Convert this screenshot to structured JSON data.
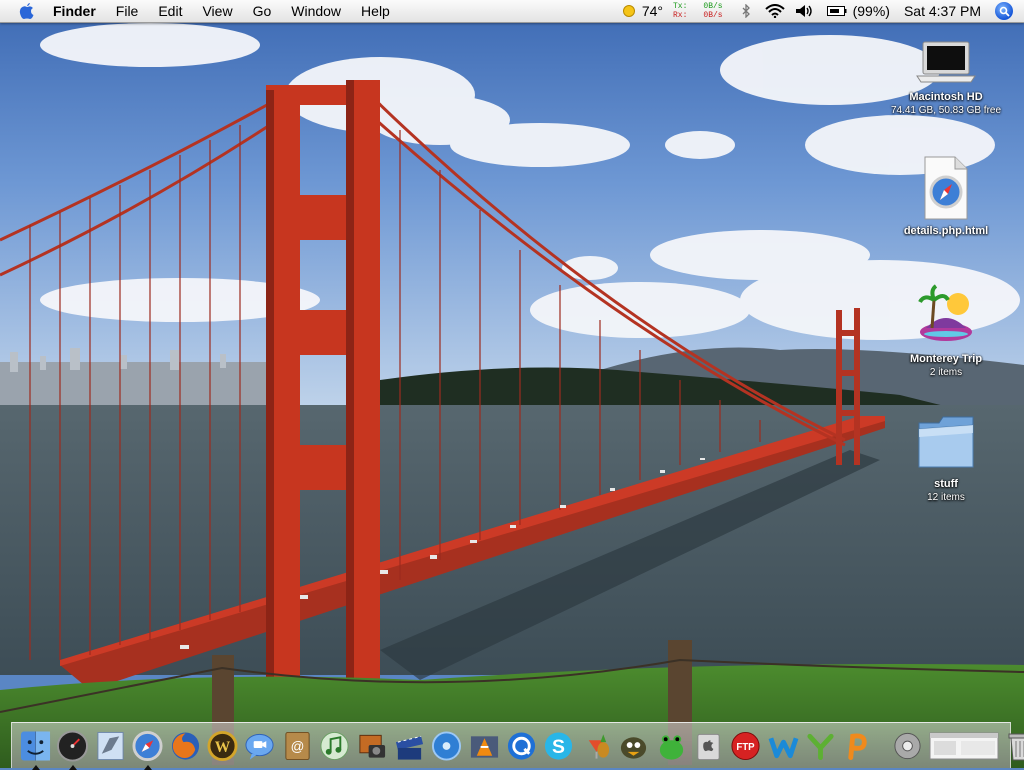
{
  "menubar": {
    "app_name": "Finder",
    "menus": [
      "File",
      "Edit",
      "View",
      "Go",
      "Window",
      "Help"
    ],
    "status": {
      "weather_temp": "74°",
      "net_tx_label": "Tx:",
      "net_tx_value": "0B/s",
      "net_rx_label": "Rx:",
      "net_rx_value": "0B/s",
      "battery": "(99%)",
      "clock": "Sat 4:37 PM"
    }
  },
  "desktop": {
    "icons": [
      {
        "name": "Macintosh HD",
        "detail": "74.41 GB, 50.83 GB free",
        "icon": "hard-drive-icon"
      },
      {
        "name": "details.php.html",
        "detail": "",
        "icon": "safari-document-icon"
      },
      {
        "name": "Monterey Trip",
        "detail": "2 items",
        "icon": "island-folder-icon"
      },
      {
        "name": "stuff",
        "detail": "12 items",
        "icon": "folder-icon"
      }
    ]
  },
  "dock": {
    "apps": [
      {
        "name": "Finder",
        "icon": "finder-icon",
        "running": true
      },
      {
        "name": "Dashboard",
        "icon": "dashboard-icon",
        "running": true
      },
      {
        "name": "Mail",
        "icon": "mail-icon",
        "running": false
      },
      {
        "name": "Safari",
        "icon": "safari-icon",
        "running": true
      },
      {
        "name": "Firefox",
        "icon": "firefox-icon",
        "running": false
      },
      {
        "name": "World of Warcraft",
        "icon": "warcraft-icon",
        "running": false
      },
      {
        "name": "iChat",
        "icon": "ichat-icon",
        "running": false
      },
      {
        "name": "Address Book",
        "icon": "address-book-icon",
        "running": false
      },
      {
        "name": "iTunes",
        "icon": "itunes-icon",
        "running": false
      },
      {
        "name": "iPhoto",
        "icon": "iphoto-icon",
        "running": false
      },
      {
        "name": "iMovie",
        "icon": "imovie-icon",
        "running": false
      },
      {
        "name": "iDVD",
        "icon": "idvd-icon",
        "running": false
      },
      {
        "name": "VLC",
        "icon": "vlc-icon",
        "running": false
      },
      {
        "name": "QuickTime",
        "icon": "quicktime-icon",
        "running": false
      },
      {
        "name": "Skype",
        "icon": "skype-icon",
        "running": false
      },
      {
        "name": "Tropical Drink",
        "icon": "drink-icon",
        "running": false
      },
      {
        "name": "Adium",
        "icon": "duck-icon",
        "running": false
      },
      {
        "name": "Frog App",
        "icon": "frog-icon",
        "running": false
      },
      {
        "name": "Boot Camp",
        "icon": "boot-camp-icon",
        "running": false
      },
      {
        "name": "FTP",
        "icon": "ftp-icon",
        "running": false
      },
      {
        "name": "W App",
        "icon": "w-app-icon",
        "running": false
      },
      {
        "name": "Y App",
        "icon": "y-app-icon",
        "running": false
      },
      {
        "name": "P App",
        "icon": "p-app-icon",
        "running": false
      }
    ],
    "right": [
      {
        "name": "System Preferences",
        "icon": "gear-icon"
      },
      {
        "name": "Window Minimized",
        "icon": "minimized-window-icon"
      },
      {
        "name": "Trash",
        "icon": "trash-icon"
      }
    ]
  }
}
